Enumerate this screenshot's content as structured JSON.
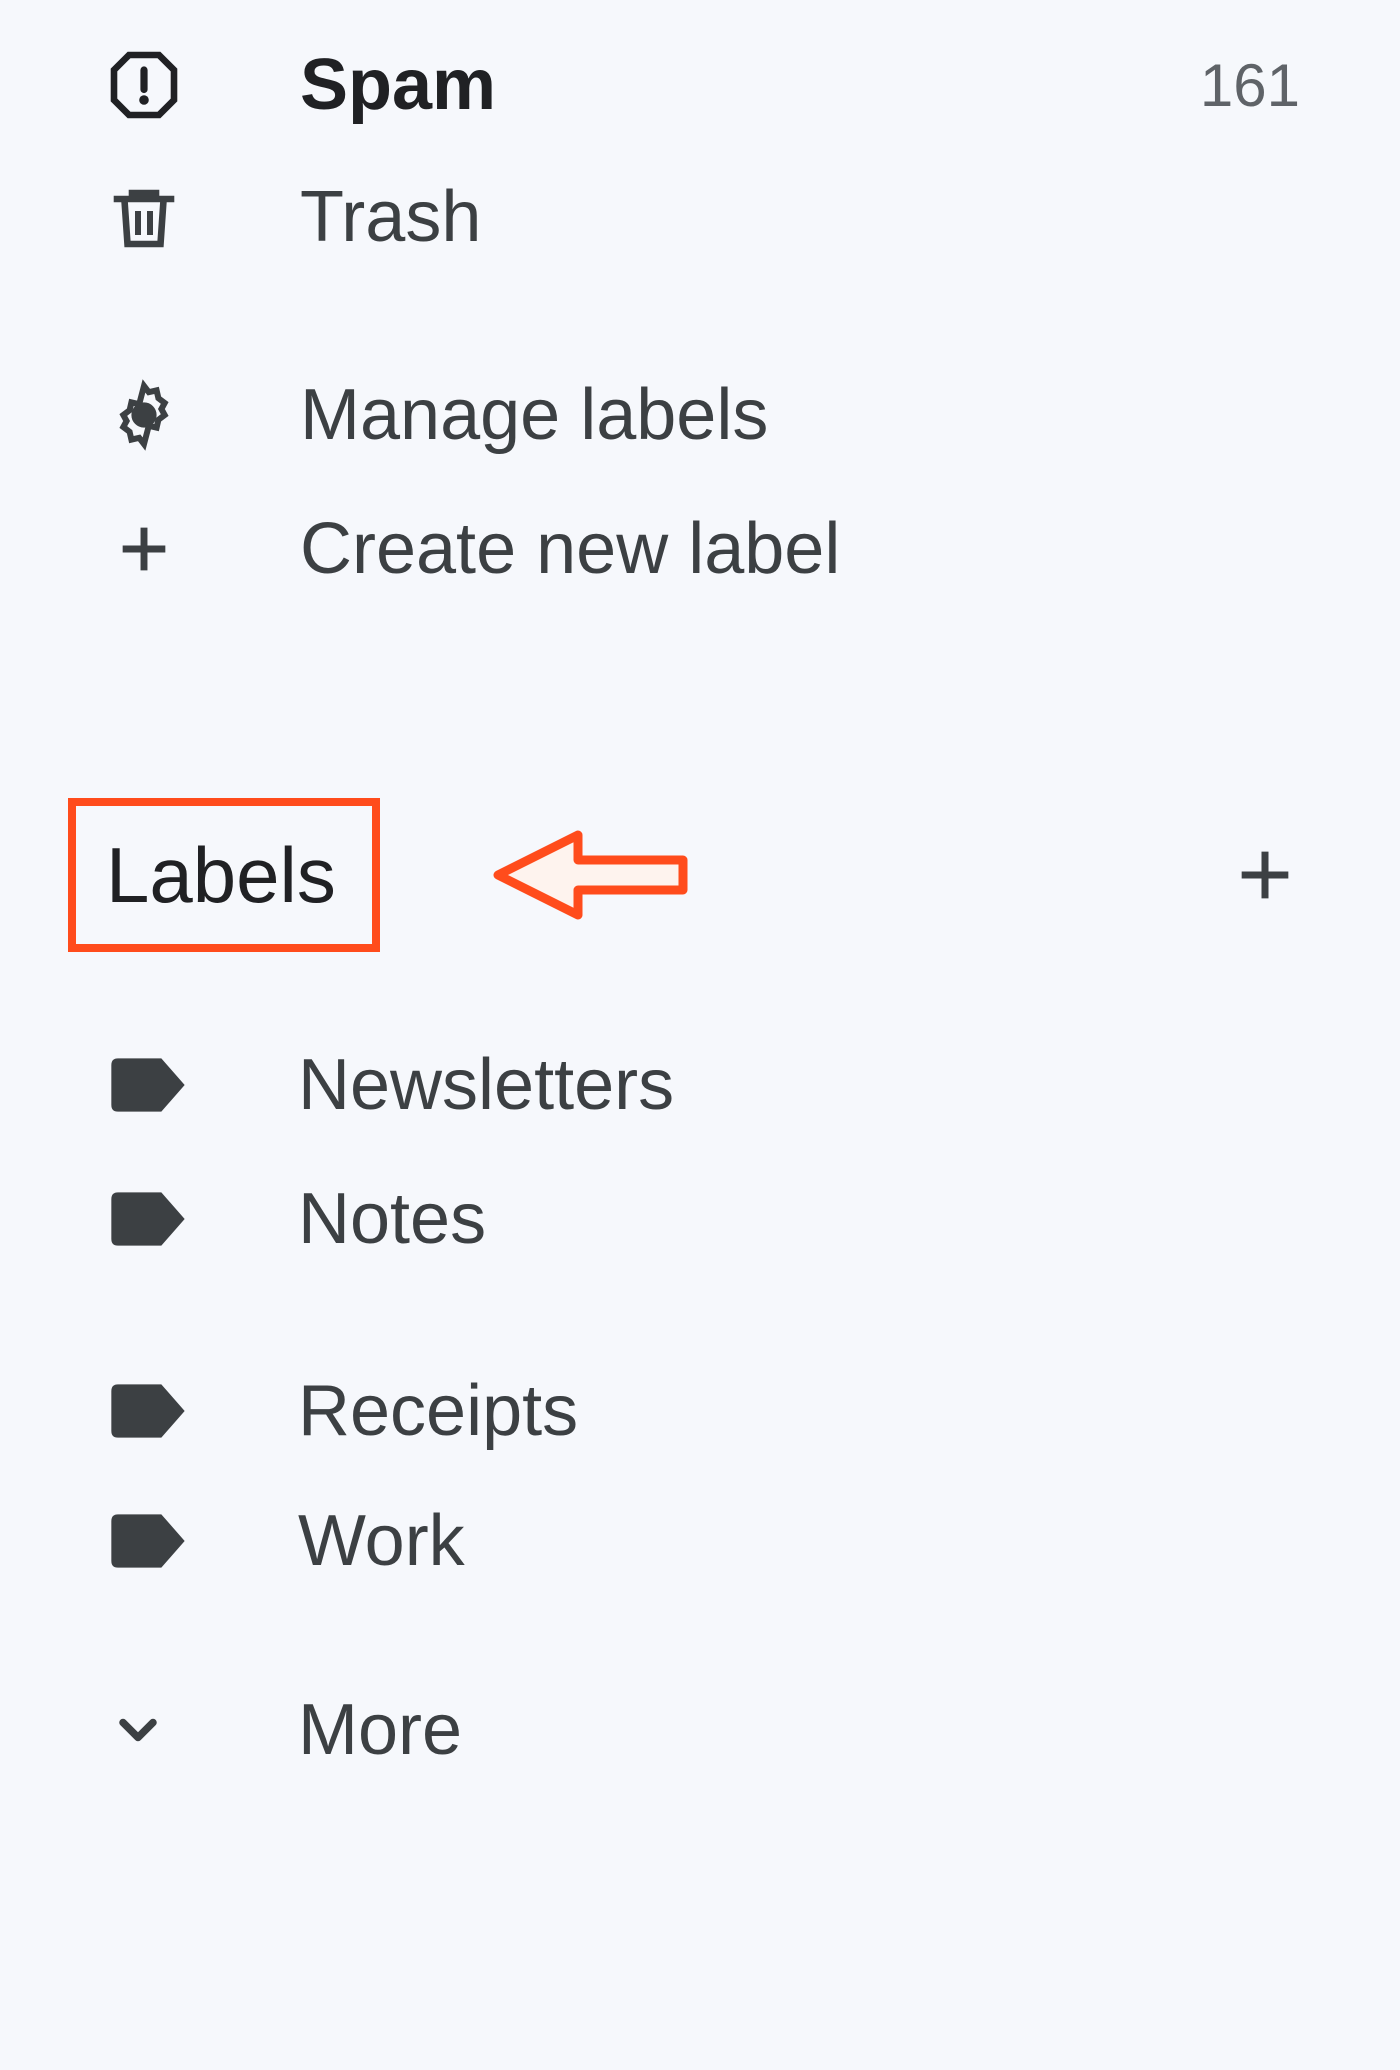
{
  "sidebar": {
    "system_folders": [
      {
        "name": "Spam",
        "count": "161",
        "icon": "spam-icon",
        "bold": true
      },
      {
        "name": "Trash",
        "count": "",
        "icon": "trash-icon",
        "bold": false
      }
    ],
    "actions": [
      {
        "name": "Manage labels",
        "icon": "gear-icon"
      },
      {
        "name": "Create new label",
        "icon": "plus-icon"
      }
    ],
    "labels_section": {
      "title": "Labels",
      "add_icon": "plus-icon"
    },
    "user_labels": [
      {
        "name": "Newsletters",
        "icon": "label-icon"
      },
      {
        "name": "Notes",
        "icon": "label-icon"
      },
      {
        "name": "Receipts",
        "icon": "label-icon"
      },
      {
        "name": "Work",
        "icon": "label-icon"
      }
    ],
    "more": {
      "name": "More",
      "icon": "chevron-down-icon"
    }
  },
  "annotation": {
    "target": "Labels",
    "type": "highlight-box-and-arrow"
  }
}
